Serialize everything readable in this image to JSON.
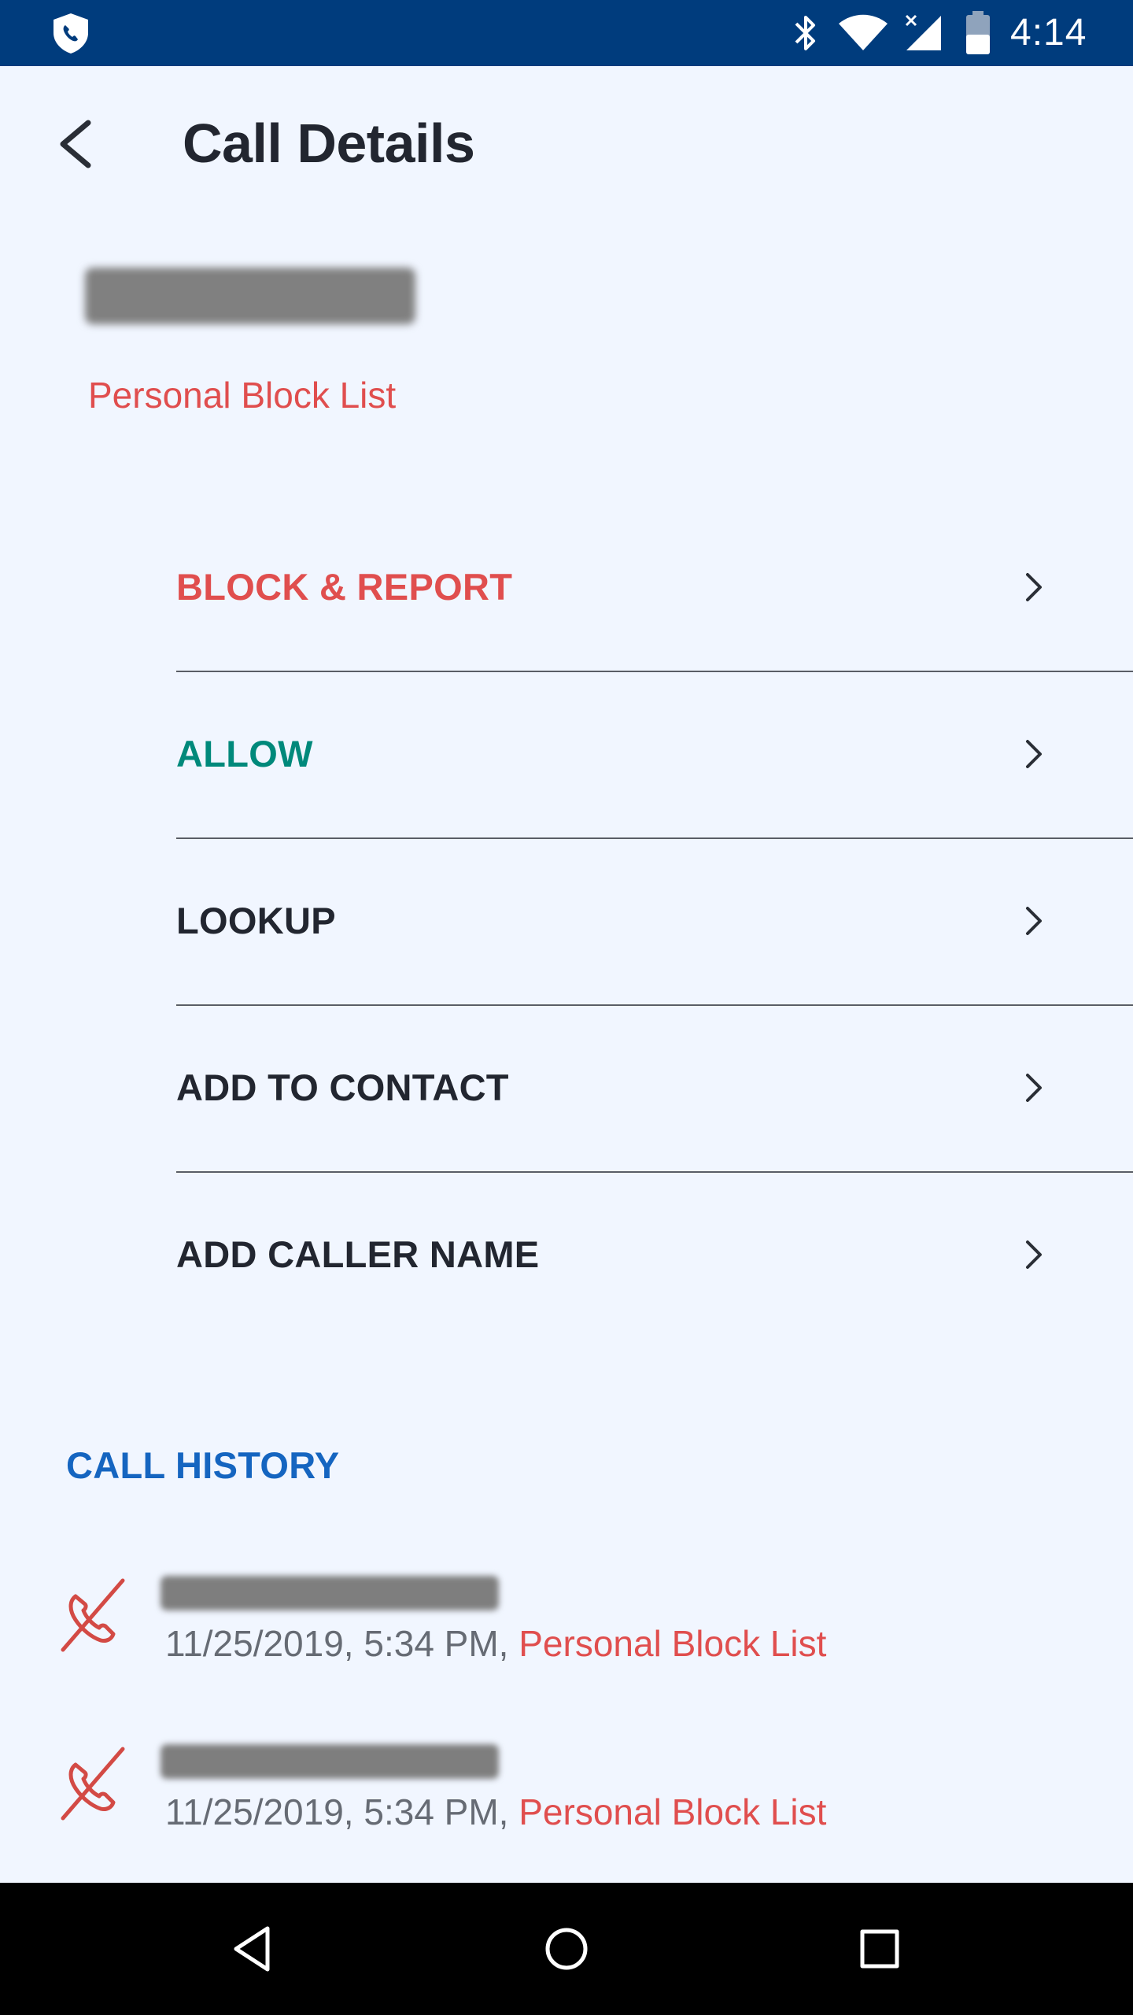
{
  "status_bar": {
    "time": "4:14",
    "icons": [
      "shield-phone-icon",
      "bluetooth-icon",
      "wifi-icon",
      "signal-icon",
      "battery-icon"
    ]
  },
  "header": {
    "title": "Call Details",
    "back_icon": "back-arrow-icon"
  },
  "caller": {
    "number": "",
    "source": "Personal Block List"
  },
  "actions": [
    {
      "label": "BLOCK & REPORT",
      "color": "#E04E4E"
    },
    {
      "label": "ALLOW",
      "color": "#00897B"
    },
    {
      "label": "LOOKUP",
      "color": "#222630"
    },
    {
      "label": "ADD TO CONTACT",
      "color": "#222630"
    },
    {
      "label": "ADD CALLER NAME",
      "color": "#222630"
    }
  ],
  "history": {
    "heading": "CALL HISTORY",
    "heading_color": "#1565C0",
    "items": [
      {
        "icon": "missed-call-icon",
        "number": "",
        "timestamp": "11/25/2019, 5:34 PM,",
        "source": "Personal Block List"
      },
      {
        "icon": "missed-call-icon",
        "number": "",
        "timestamp": "11/25/2019, 5:34 PM,",
        "source": "Personal Block List"
      }
    ]
  },
  "nav_bar": {
    "buttons": [
      "back-triangle-icon",
      "home-circle-icon",
      "recents-square-icon"
    ]
  },
  "colors": {
    "status_bar": "#003C7D",
    "background": "#F1F6FF",
    "block": "#E04E4E",
    "allow": "#00897B",
    "history_heading": "#1565C0"
  }
}
